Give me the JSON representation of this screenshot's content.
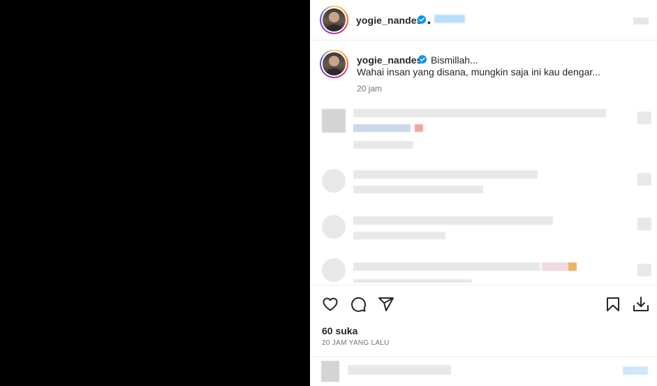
{
  "header": {
    "username": "yogie_nandes",
    "separator": "•"
  },
  "caption": {
    "username": "yogie_nandes",
    "title": "Bismillah...",
    "body": "Wahai insan yang disana, mungkin saja ini kau dengar...",
    "time": "20 jam"
  },
  "stats": {
    "likes": "60 suka",
    "posted": "20 JAM YANG LALU"
  },
  "icons": {
    "verified": "verified-badge-icon",
    "like": "heart-icon",
    "comment": "comment-icon",
    "share": "send-icon",
    "save": "bookmark-icon",
    "download": "download-icon"
  },
  "colors": {
    "verified": "#0095f6",
    "text": "#262626",
    "secondary": "#737373"
  }
}
